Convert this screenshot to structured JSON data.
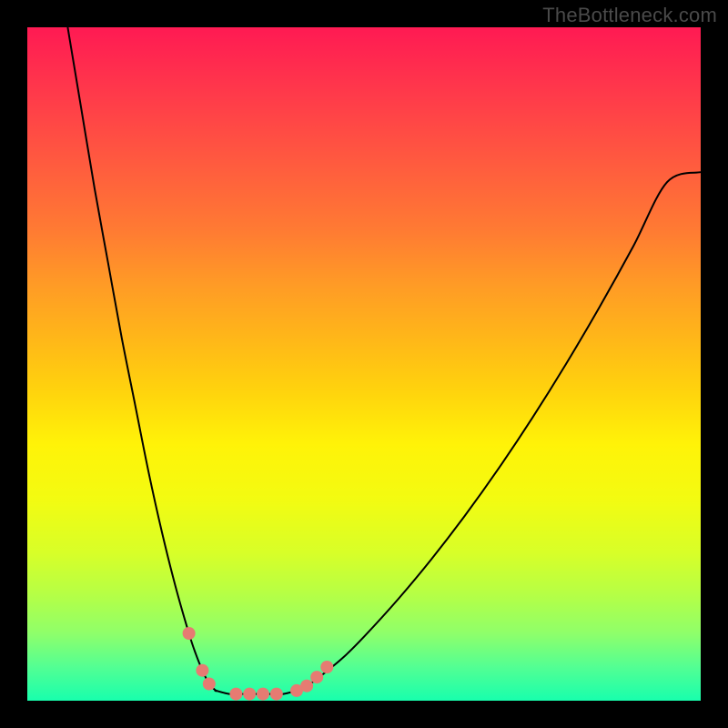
{
  "watermark": "TheBottleneck.com",
  "chart_data": {
    "type": "line",
    "title": "",
    "xlabel": "",
    "ylabel": "",
    "xlim": [
      0,
      100
    ],
    "ylim": [
      0,
      100
    ],
    "grid": false,
    "background_gradient": {
      "top": "#ff1a53",
      "bottom": "#18ffad"
    },
    "series": [
      {
        "name": "left-branch",
        "x": [
          6,
          8,
          10,
          12,
          14,
          16,
          18,
          20,
          22,
          24,
          25,
          26,
          27,
          28
        ],
        "values": [
          100,
          88,
          76,
          65,
          54,
          44,
          34,
          25,
          17,
          10,
          7,
          4.5,
          2.5,
          1.5
        ]
      },
      {
        "name": "bottom-segment",
        "x": [
          28,
          30,
          32,
          34,
          36,
          38,
          40
        ],
        "values": [
          1.5,
          1,
          1,
          1,
          1,
          1,
          1.5
        ]
      },
      {
        "name": "right-branch",
        "x": [
          40,
          42,
          44,
          47,
          50,
          55,
          60,
          65,
          70,
          75,
          80,
          85,
          90,
          95,
          100
        ],
        "values": [
          1.5,
          2.5,
          4,
          6.5,
          9.5,
          15,
          21,
          27.5,
          34.5,
          42,
          50,
          58.5,
          67.5,
          77,
          78.5
        ]
      }
    ],
    "markers": [
      {
        "x": 24,
        "y": 10
      },
      {
        "x": 26,
        "y": 4.5
      },
      {
        "x": 27,
        "y": 2.5
      },
      {
        "x": 31,
        "y": 1
      },
      {
        "x": 33,
        "y": 1
      },
      {
        "x": 35,
        "y": 1
      },
      {
        "x": 37,
        "y": 1
      },
      {
        "x": 40,
        "y": 1.5
      },
      {
        "x": 41.5,
        "y": 2.2
      },
      {
        "x": 43,
        "y": 3.5
      },
      {
        "x": 44.5,
        "y": 5
      }
    ],
    "marker_color": "#e67b72",
    "marker_radius_px": 7
  }
}
